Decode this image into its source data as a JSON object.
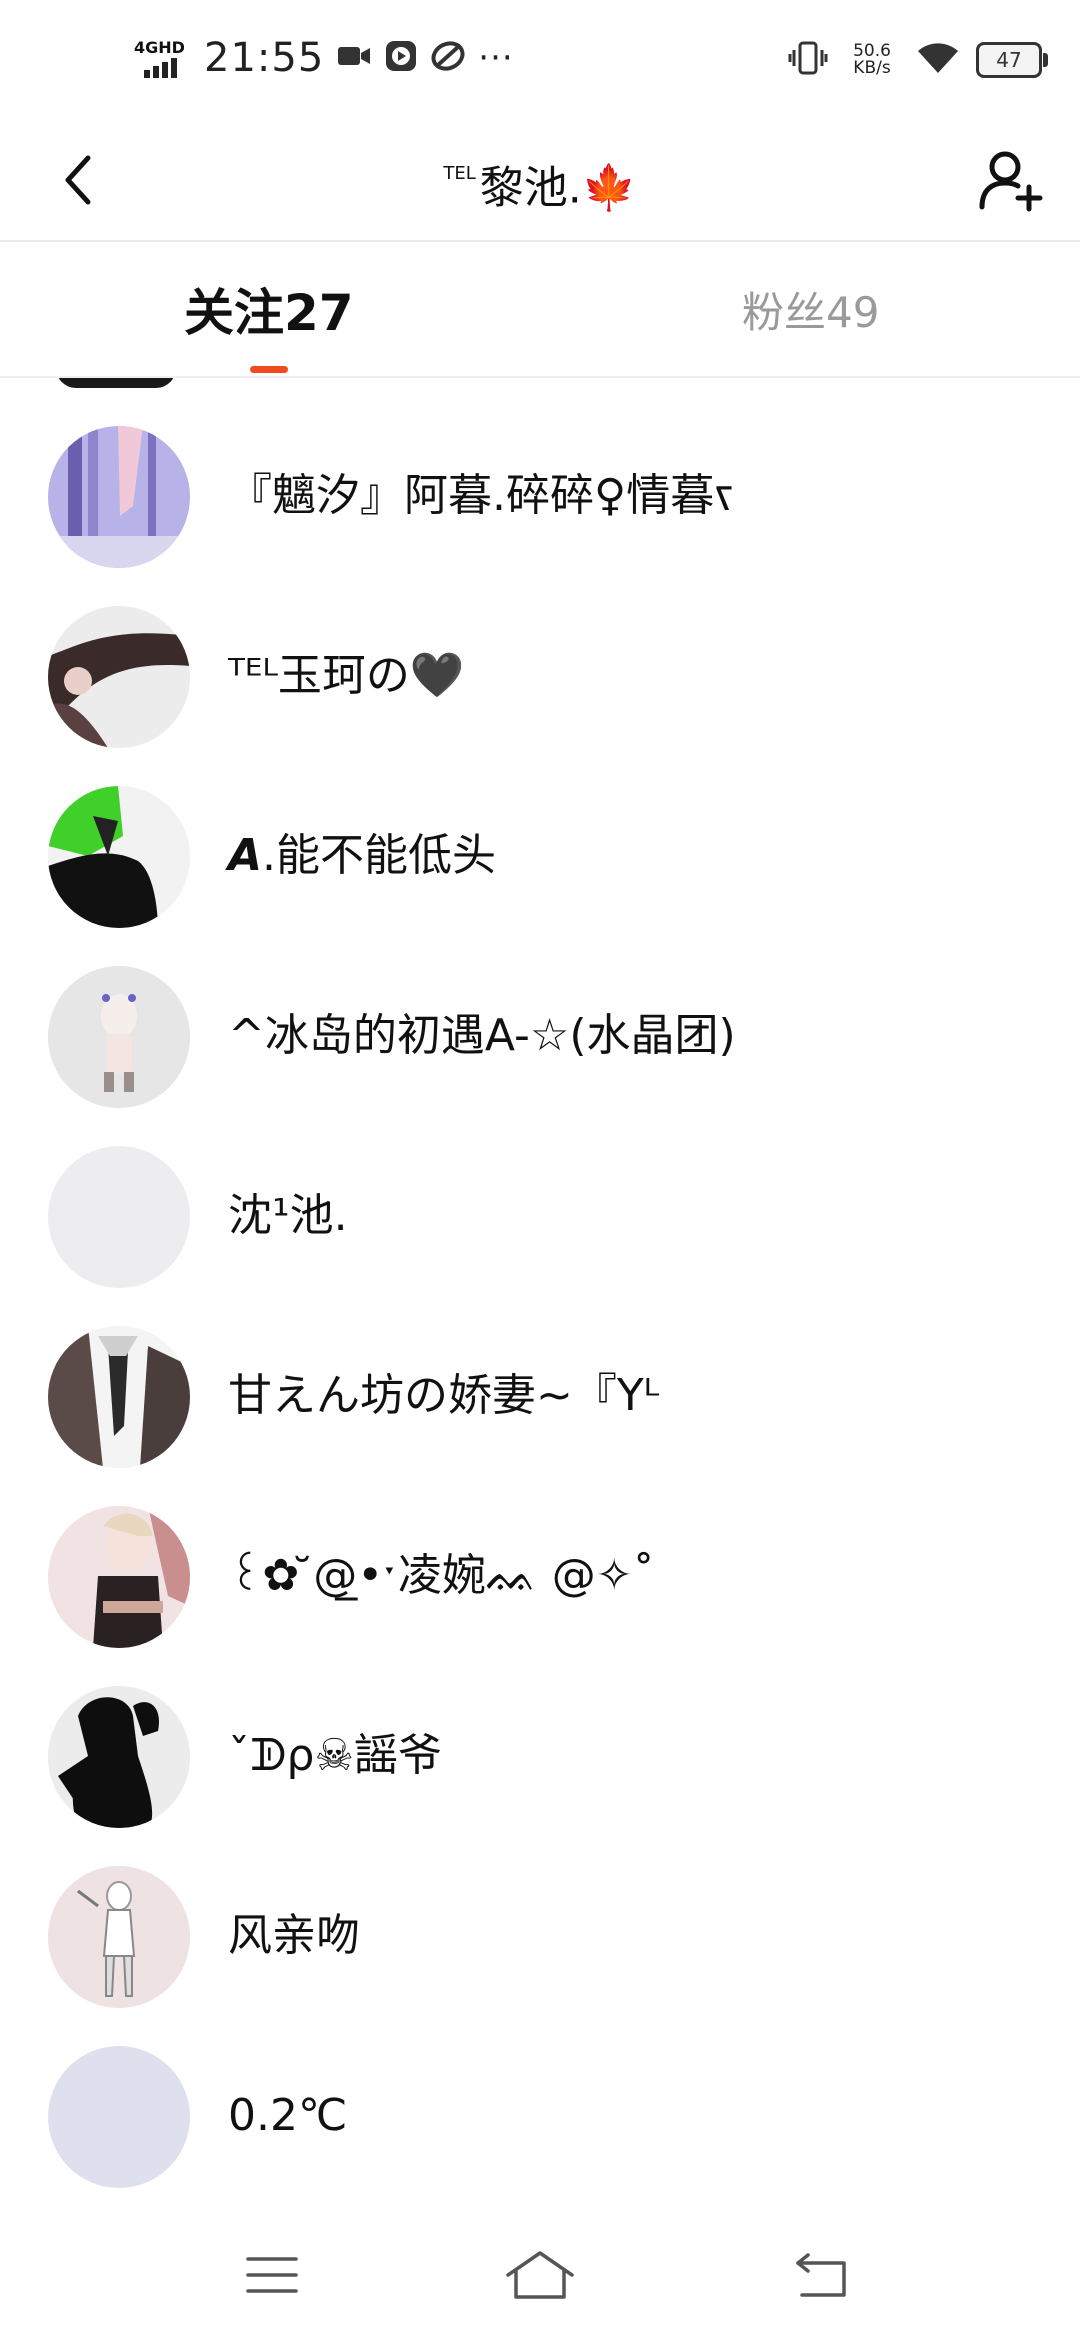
{
  "status_bar": {
    "network": "4GHD",
    "time": "21:55",
    "more_indicator": "···",
    "speed_value": "50.6",
    "speed_unit": "KB/s",
    "battery": "47"
  },
  "header": {
    "title_sup": "TEL",
    "title": "黎池.",
    "title_emoji": "🍁",
    "back_icon": "chevron-left",
    "add_icon": "add-user"
  },
  "tabs": {
    "following": "关注27",
    "followers": "粉丝49",
    "active": "following",
    "accent": "#f04a1e"
  },
  "users": [
    {
      "name": "『魑汐』阿暮.碎碎♀情暮ꧏ"
    },
    {
      "name": "ᵀᴱᴸ玉珂の🖤"
    },
    {
      "name": "𝘼.能不能低头"
    },
    {
      "name": "^冰岛的初遇A-☆(水晶团)"
    },
    {
      "name": "沈¹池."
    },
    {
      "name": "甘えん坊の娇妻~『Yᴸ"
    },
    {
      "name": "꒰✿ ̆@̲•ˑ凌婉ᨐ @✧˚"
    },
    {
      "name": "ˇᗫρ☠謡爷"
    },
    {
      "name": "风亲吻"
    },
    {
      "name": "0.2℃"
    }
  ],
  "nav": {
    "menu_icon": "menu",
    "home_icon": "home",
    "back_icon": "back"
  }
}
